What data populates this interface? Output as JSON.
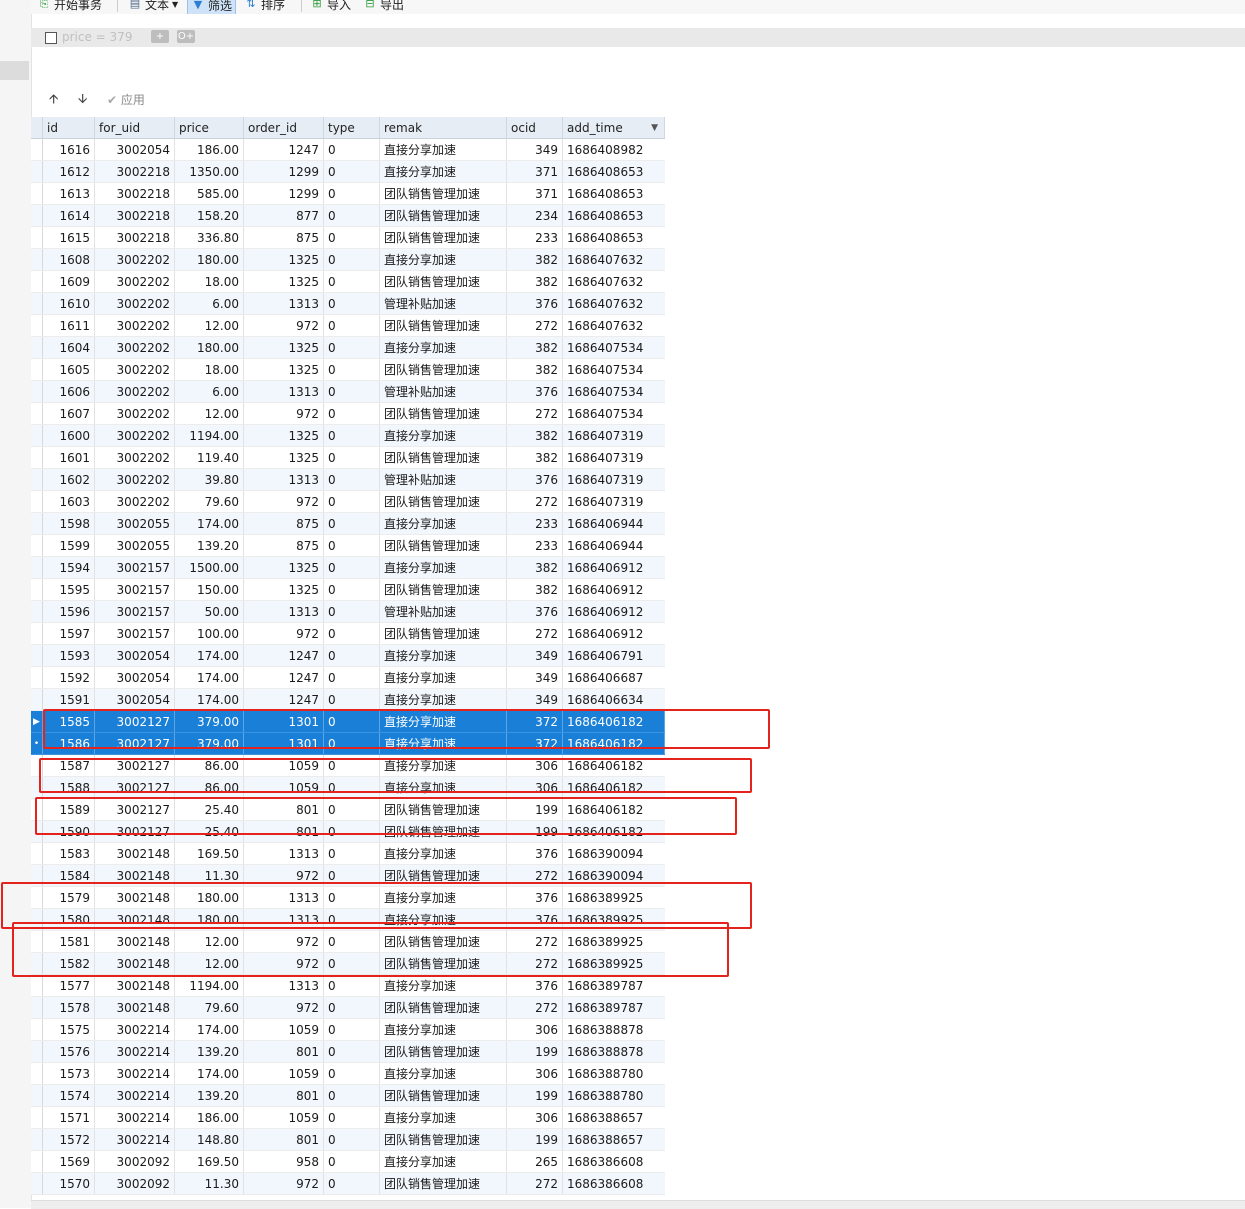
{
  "toolbar": {
    "begin_transaction": "开始事务",
    "text": "文本",
    "filter": "筛选",
    "sort": "排序",
    "import": "导入",
    "export": "导出"
  },
  "filter": {
    "expression": "price  =  379",
    "add_label": "+",
    "add_group_label": "O+"
  },
  "actions": {
    "up": "🡩",
    "down": "🡫",
    "apply": "应用"
  },
  "table": {
    "columns": [
      "id",
      "for_uid",
      "price",
      "order_id",
      "type",
      "remak",
      "ocid",
      "add_time"
    ],
    "rows": [
      [
        "1616",
        "3002054",
        "186.00",
        "1247",
        "0",
        "直接分享加速",
        "349",
        "1686408982"
      ],
      [
        "1612",
        "3002218",
        "1350.00",
        "1299",
        "0",
        "直接分享加速",
        "371",
        "1686408653"
      ],
      [
        "1613",
        "3002218",
        "585.00",
        "1299",
        "0",
        "团队销售管理加速",
        "371",
        "1686408653"
      ],
      [
        "1614",
        "3002218",
        "158.20",
        "877",
        "0",
        "团队销售管理加速",
        "234",
        "1686408653"
      ],
      [
        "1615",
        "3002218",
        "336.80",
        "875",
        "0",
        "团队销售管理加速",
        "233",
        "1686408653"
      ],
      [
        "1608",
        "3002202",
        "180.00",
        "1325",
        "0",
        "直接分享加速",
        "382",
        "1686407632"
      ],
      [
        "1609",
        "3002202",
        "18.00",
        "1325",
        "0",
        "团队销售管理加速",
        "382",
        "1686407632"
      ],
      [
        "1610",
        "3002202",
        "6.00",
        "1313",
        "0",
        "管理补贴加速",
        "376",
        "1686407632"
      ],
      [
        "1611",
        "3002202",
        "12.00",
        "972",
        "0",
        "团队销售管理加速",
        "272",
        "1686407632"
      ],
      [
        "1604",
        "3002202",
        "180.00",
        "1325",
        "0",
        "直接分享加速",
        "382",
        "1686407534"
      ],
      [
        "1605",
        "3002202",
        "18.00",
        "1325",
        "0",
        "团队销售管理加速",
        "382",
        "1686407534"
      ],
      [
        "1606",
        "3002202",
        "6.00",
        "1313",
        "0",
        "管理补贴加速",
        "376",
        "1686407534"
      ],
      [
        "1607",
        "3002202",
        "12.00",
        "972",
        "0",
        "团队销售管理加速",
        "272",
        "1686407534"
      ],
      [
        "1600",
        "3002202",
        "1194.00",
        "1325",
        "0",
        "直接分享加速",
        "382",
        "1686407319"
      ],
      [
        "1601",
        "3002202",
        "119.40",
        "1325",
        "0",
        "团队销售管理加速",
        "382",
        "1686407319"
      ],
      [
        "1602",
        "3002202",
        "39.80",
        "1313",
        "0",
        "管理补贴加速",
        "376",
        "1686407319"
      ],
      [
        "1603",
        "3002202",
        "79.60",
        "972",
        "0",
        "团队销售管理加速",
        "272",
        "1686407319"
      ],
      [
        "1598",
        "3002055",
        "174.00",
        "875",
        "0",
        "直接分享加速",
        "233",
        "1686406944"
      ],
      [
        "1599",
        "3002055",
        "139.20",
        "875",
        "0",
        "团队销售管理加速",
        "233",
        "1686406944"
      ],
      [
        "1594",
        "3002157",
        "1500.00",
        "1325",
        "0",
        "直接分享加速",
        "382",
        "1686406912"
      ],
      [
        "1595",
        "3002157",
        "150.00",
        "1325",
        "0",
        "团队销售管理加速",
        "382",
        "1686406912"
      ],
      [
        "1596",
        "3002157",
        "50.00",
        "1313",
        "0",
        "管理补贴加速",
        "376",
        "1686406912"
      ],
      [
        "1597",
        "3002157",
        "100.00",
        "972",
        "0",
        "团队销售管理加速",
        "272",
        "1686406912"
      ],
      [
        "1593",
        "3002054",
        "174.00",
        "1247",
        "0",
        "直接分享加速",
        "349",
        "1686406791"
      ],
      [
        "1592",
        "3002054",
        "174.00",
        "1247",
        "0",
        "直接分享加速",
        "349",
        "1686406687"
      ],
      [
        "1591",
        "3002054",
        "174.00",
        "1247",
        "0",
        "直接分享加速",
        "349",
        "1686406634"
      ],
      [
        "1585",
        "3002127",
        "379.00",
        "1301",
        "0",
        "直接分享加速",
        "372",
        "1686406182"
      ],
      [
        "1586",
        "3002127",
        "379.00",
        "1301",
        "0",
        "直接分享加速",
        "372",
        "1686406182"
      ],
      [
        "1587",
        "3002127",
        "86.00",
        "1059",
        "0",
        "直接分享加速",
        "306",
        "1686406182"
      ],
      [
        "1588",
        "3002127",
        "86.00",
        "1059",
        "0",
        "直接分享加速",
        "306",
        "1686406182"
      ],
      [
        "1589",
        "3002127",
        "25.40",
        "801",
        "0",
        "团队销售管理加速",
        "199",
        "1686406182"
      ],
      [
        "1590",
        "3002127",
        "25.40",
        "801",
        "0",
        "团队销售管理加速",
        "199",
        "1686406182"
      ],
      [
        "1583",
        "3002148",
        "169.50",
        "1313",
        "0",
        "直接分享加速",
        "376",
        "1686390094"
      ],
      [
        "1584",
        "3002148",
        "11.30",
        "972",
        "0",
        "团队销售管理加速",
        "272",
        "1686390094"
      ],
      [
        "1579",
        "3002148",
        "180.00",
        "1313",
        "0",
        "直接分享加速",
        "376",
        "1686389925"
      ],
      [
        "1580",
        "3002148",
        "180.00",
        "1313",
        "0",
        "直接分享加速",
        "376",
        "1686389925"
      ],
      [
        "1581",
        "3002148",
        "12.00",
        "972",
        "0",
        "团队销售管理加速",
        "272",
        "1686389925"
      ],
      [
        "1582",
        "3002148",
        "12.00",
        "972",
        "0",
        "团队销售管理加速",
        "272",
        "1686389925"
      ],
      [
        "1577",
        "3002148",
        "1194.00",
        "1313",
        "0",
        "直接分享加速",
        "376",
        "1686389787"
      ],
      [
        "1578",
        "3002148",
        "79.60",
        "972",
        "0",
        "团队销售管理加速",
        "272",
        "1686389787"
      ],
      [
        "1575",
        "3002214",
        "174.00",
        "1059",
        "0",
        "直接分享加速",
        "306",
        "1686388878"
      ],
      [
        "1576",
        "3002214",
        "139.20",
        "801",
        "0",
        "团队销售管理加速",
        "199",
        "1686388878"
      ],
      [
        "1573",
        "3002214",
        "174.00",
        "1059",
        "0",
        "直接分享加速",
        "306",
        "1686388780"
      ],
      [
        "1574",
        "3002214",
        "139.20",
        "801",
        "0",
        "团队销售管理加速",
        "199",
        "1686388780"
      ],
      [
        "1571",
        "3002214",
        "186.00",
        "1059",
        "0",
        "直接分享加速",
        "306",
        "1686388657"
      ],
      [
        "1572",
        "3002214",
        "148.80",
        "801",
        "0",
        "团队销售管理加速",
        "199",
        "1686388657"
      ],
      [
        "1569",
        "3002092",
        "169.50",
        "958",
        "0",
        "直接分享加速",
        "265",
        "1686386608"
      ],
      [
        "1570",
        "3002092",
        "11.30",
        "972",
        "0",
        "团队销售管理加速",
        "272",
        "1686386608"
      ]
    ],
    "selected_rows": [
      26,
      27
    ],
    "current_row_marker": "▶",
    "selected_row_marker": "•"
  },
  "colors": {
    "selection": "#1a7fd6",
    "annotation": "#e4231c",
    "alt_row": "#f2f7fd"
  }
}
